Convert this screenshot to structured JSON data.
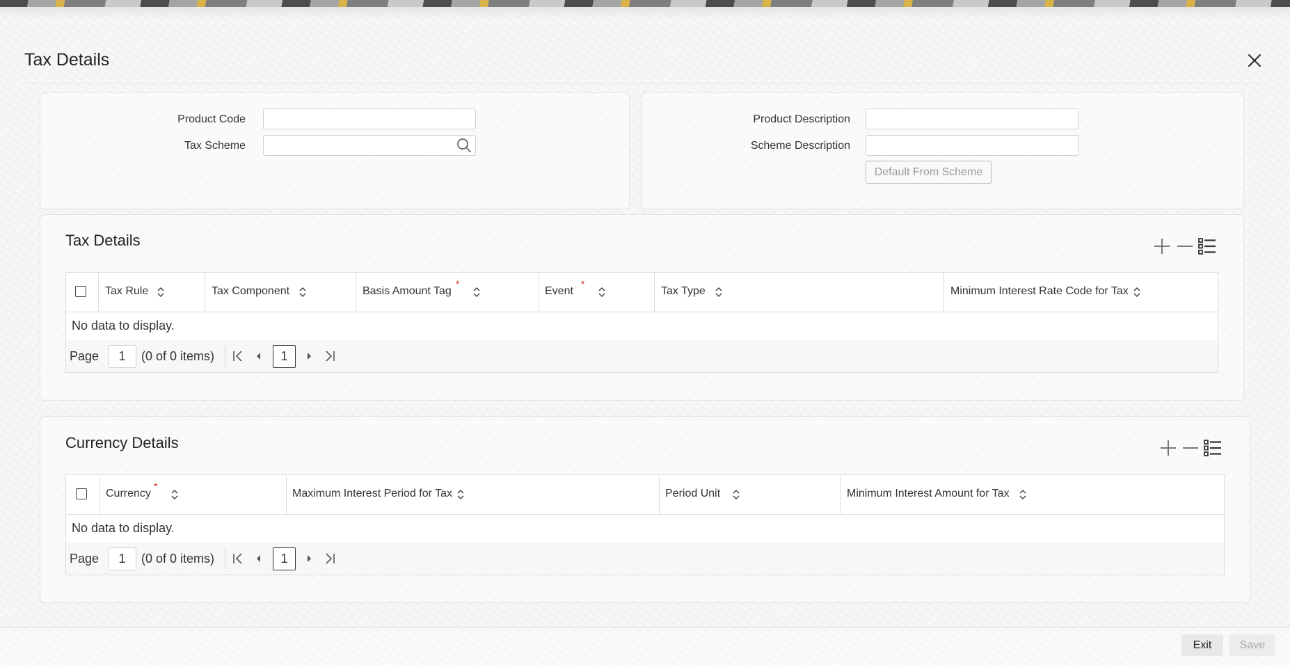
{
  "dialog": {
    "title": "Tax Details"
  },
  "header_fields": {
    "product_code": {
      "label": "Product Code",
      "value": ""
    },
    "tax_scheme": {
      "label": "Tax Scheme",
      "value": ""
    },
    "product_description": {
      "label": "Product Description",
      "value": ""
    },
    "scheme_description": {
      "label": "Scheme Description",
      "value": ""
    },
    "default_button": "Default From Scheme"
  },
  "tax_details": {
    "title": "Tax Details",
    "columns": [
      {
        "label": "Tax Rule",
        "required": false
      },
      {
        "label": "Tax Component",
        "required": false
      },
      {
        "label": "Basis Amount Tag",
        "required": true
      },
      {
        "label": "Event",
        "required": true
      },
      {
        "label": "Tax Type",
        "required": false
      },
      {
        "label": "Minimum Interest Rate Code for Tax",
        "required": false
      }
    ],
    "empty_text": "No data to display.",
    "pager": {
      "label": "Page",
      "page_input": "1",
      "count_text": "(0 of 0 items)",
      "current": "1"
    }
  },
  "currency_details": {
    "title": "Currency Details",
    "columns": [
      {
        "label": "Currency",
        "required": true
      },
      {
        "label": "Maximum Interest Period for Tax",
        "required": false
      },
      {
        "label": "Period Unit",
        "required": false
      },
      {
        "label": "Minimum Interest Amount for Tax",
        "required": false
      }
    ],
    "empty_text": "No data to display.",
    "pager": {
      "label": "Page",
      "page_input": "1",
      "count_text": "(0 of 0 items)",
      "current": "1"
    }
  },
  "footer": {
    "exit_label": "Exit",
    "save_label": "Save"
  },
  "required_marker": "*",
  "colors": {
    "required": "#d62e2e",
    "save_disabled_text": "#a8a8a8",
    "button_bg": "#e8e8e8"
  }
}
